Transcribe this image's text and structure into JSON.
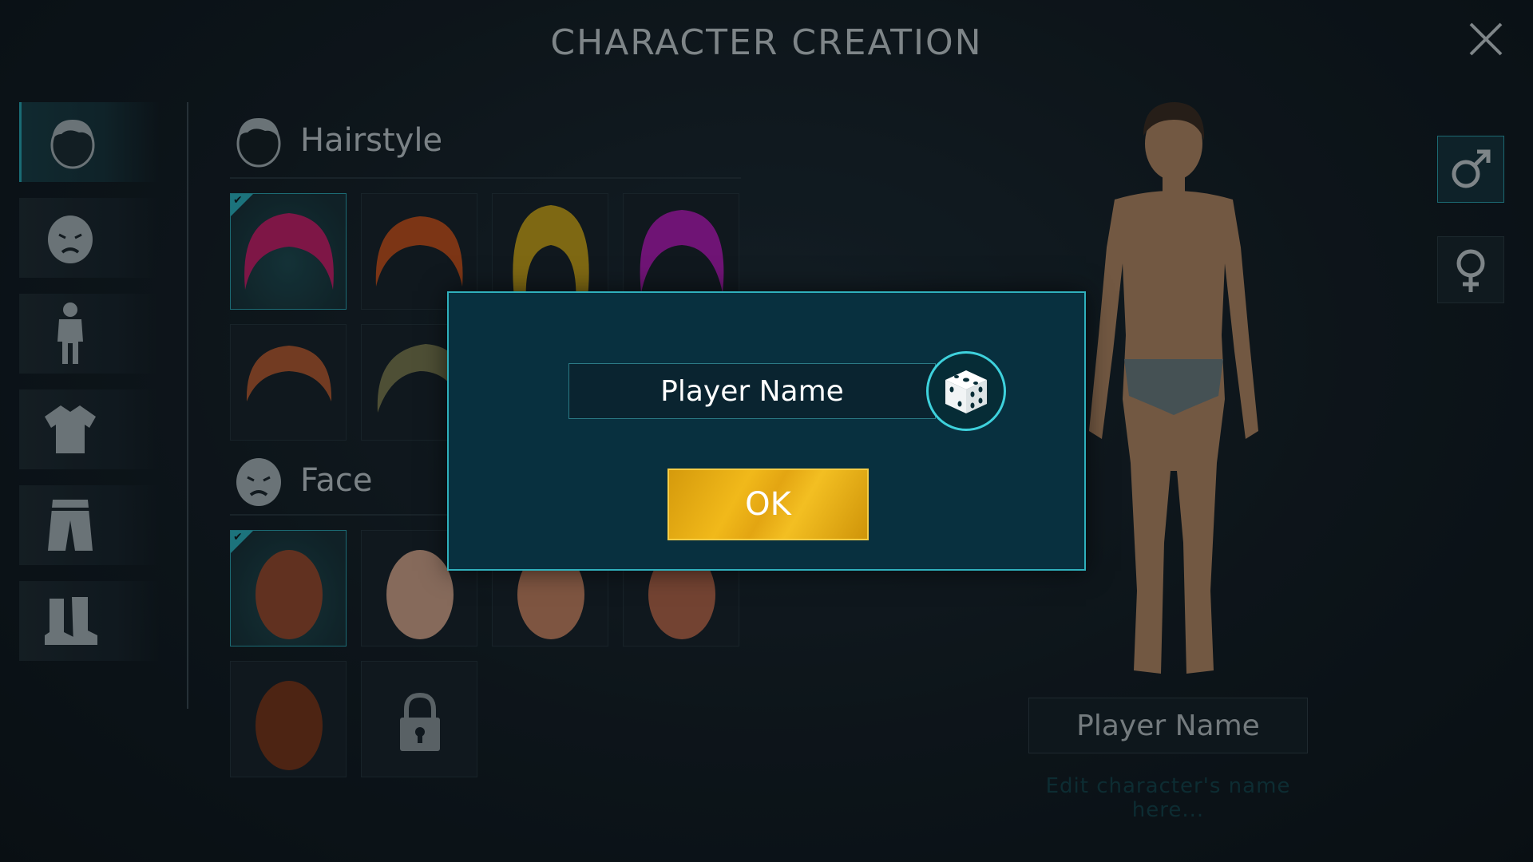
{
  "header": {
    "title": "CHARACTER CREATION"
  },
  "sidebar": {
    "categories": [
      {
        "name": "hairstyle",
        "icon": "hair-icon"
      },
      {
        "name": "face",
        "icon": "face-icon"
      },
      {
        "name": "body",
        "icon": "body-icon"
      },
      {
        "name": "shirt",
        "icon": "shirt-icon"
      },
      {
        "name": "pants",
        "icon": "pants-icon"
      },
      {
        "name": "boots",
        "icon": "boots-icon"
      }
    ]
  },
  "sections": {
    "hairstyle": {
      "label": "Hairstyle"
    },
    "face": {
      "label": "Face"
    }
  },
  "hair_colors": [
    "#c81d6a",
    "#c5501b",
    "#c8a217",
    "#b11ab5",
    "#b55a2f",
    "#7b7a4e"
  ],
  "face_colors": [
    "#9a4a2c",
    "#d6a58b",
    "#c98462",
    "#b7674a",
    "#7a3418"
  ],
  "character": {
    "name_display": "Player Name",
    "hint": "Edit character's name here..."
  },
  "modal": {
    "name_value": "Player Name",
    "ok_label": "OK"
  },
  "colors": {
    "accent": "#2fb0bc",
    "ok": "#f1b91a",
    "modal_bg": "#08303f"
  }
}
